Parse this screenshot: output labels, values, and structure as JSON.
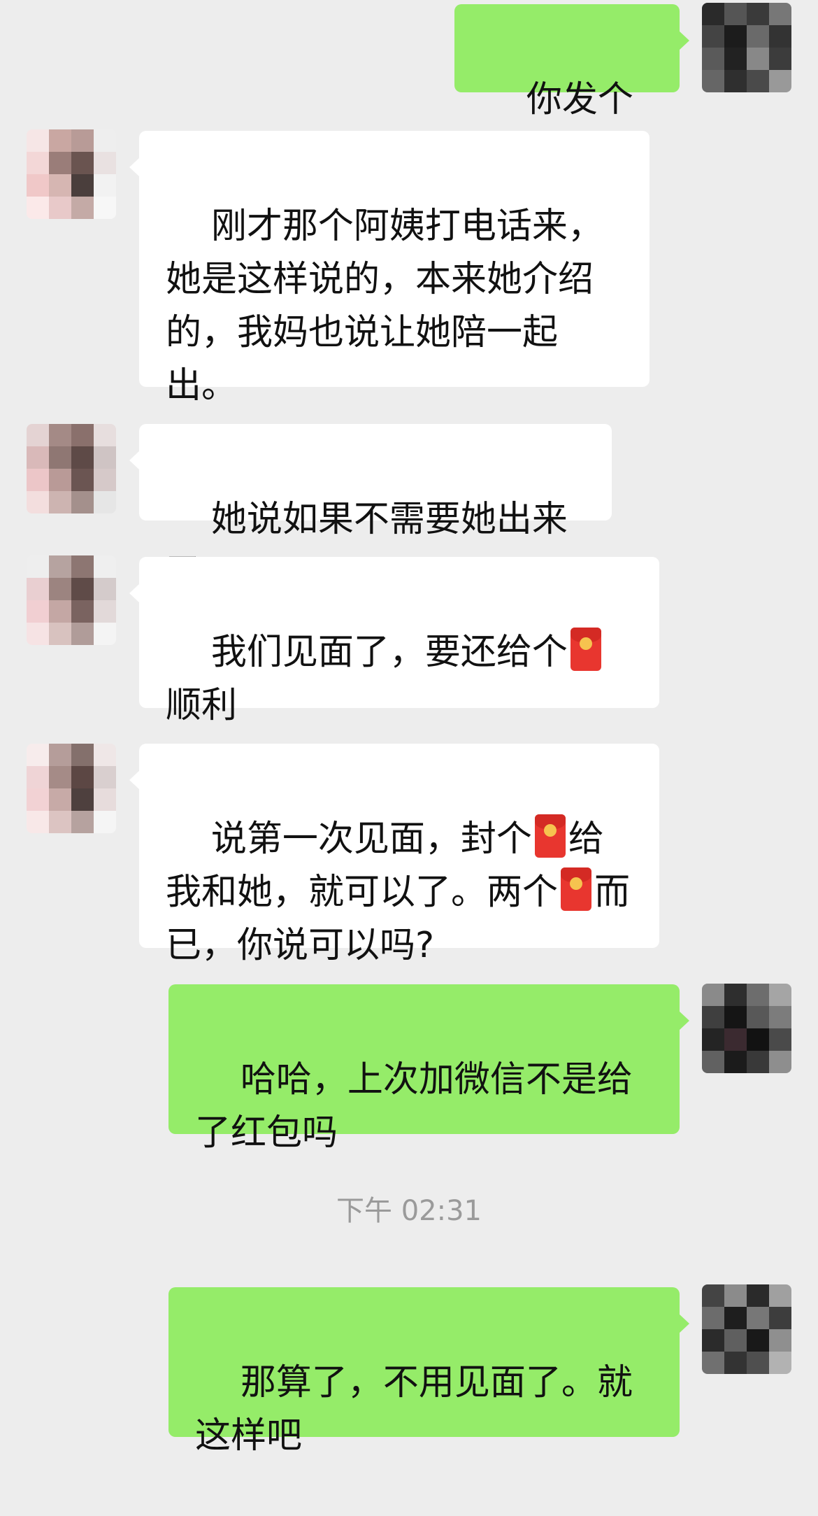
{
  "messages": [
    {
      "side": "out",
      "text": "你发个位置来"
    },
    {
      "side": "in",
      "text": "刚才那个阿姨打电话来，她是这样说的，本来她介绍的，我妈也说让她陪一起出。"
    },
    {
      "side": "in",
      "text": "她说如果不需要她出来了"
    },
    {
      "side": "in",
      "text": "我们见面了，要还给个🧧顺利"
    },
    {
      "side": "in",
      "text": "说第一次见面，封个🧧给我和她，就可以了。两个🧧而已，你说可以吗?"
    },
    {
      "side": "out",
      "text": "哈哈，上次加微信不是给了红包吗"
    },
    {
      "side": "out",
      "text": "那算了，不用见面了。就这样吧"
    }
  ],
  "timestamp": "下午 02:31",
  "colors": {
    "background": "#ededed",
    "incoming_bubble": "#ffffff",
    "outgoing_bubble": "#95ec69",
    "timestamp_text": "#9a9a9a",
    "red_packet": "#e8362f"
  },
  "icons": {
    "red_packet": "red-envelope-icon"
  }
}
